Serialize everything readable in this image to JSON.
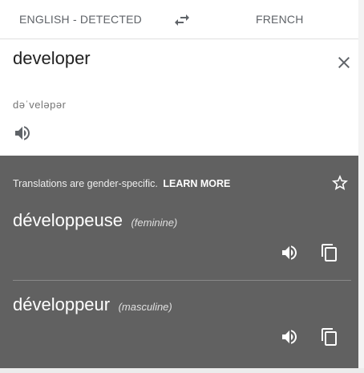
{
  "languages": {
    "source": "ENGLISH - DETECTED",
    "target": "FRENCH"
  },
  "input": {
    "text": "developer",
    "phonetic": "dəˈveləpər"
  },
  "result": {
    "notice": "Translations are gender-specific.",
    "learn_more": "LEARN MORE",
    "translations": [
      {
        "word": "développeuse",
        "gender": "(feminine)"
      },
      {
        "word": "développeur",
        "gender": "(masculine)"
      }
    ]
  },
  "colors": {
    "panel_background": "#616161",
    "icon_light": "#ffffff",
    "icon_dark": "#5f6368"
  },
  "icons": [
    "swap-icon",
    "close-icon",
    "speaker-icon",
    "star-icon",
    "copy-icon"
  ]
}
